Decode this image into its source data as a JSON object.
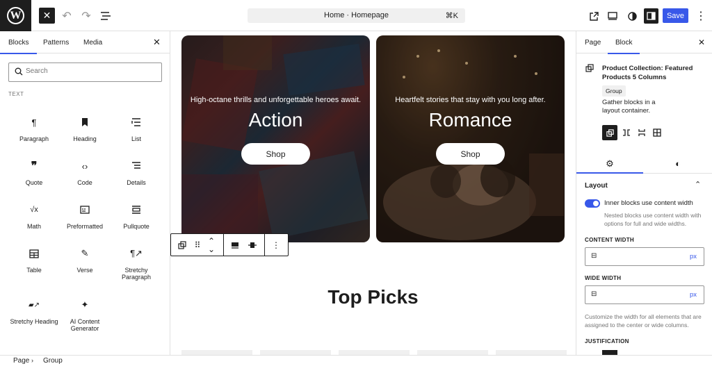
{
  "topbar": {
    "logo": "W",
    "close_icon": "close-icon",
    "document_title": "Home · Homepage",
    "shortcut": "⌘K",
    "save_label": "Save",
    "accent_color": "#3858e9"
  },
  "inserter": {
    "tabs": [
      "Blocks",
      "Patterns",
      "Media"
    ],
    "active_tab": "Blocks",
    "search_placeholder": "Search",
    "category": "TEXT",
    "blocks": [
      {
        "label": "Paragraph",
        "icon": "¶"
      },
      {
        "label": "Heading",
        "icon": "🔖"
      },
      {
        "label": "List",
        "icon": "☰"
      },
      {
        "label": "Quote",
        "icon": "❞"
      },
      {
        "label": "Code",
        "icon": "‹›"
      },
      {
        "label": "Details",
        "icon": "≡"
      },
      {
        "label": "Math",
        "icon": "√x"
      },
      {
        "label": "Preformatted",
        "icon": "▤"
      },
      {
        "label": "Pullquote",
        "icon": "▭"
      },
      {
        "label": "Table",
        "icon": "▦"
      },
      {
        "label": "Verse",
        "icon": "✎"
      },
      {
        "label": "Stretchy Paragraph",
        "icon": "¶↗"
      },
      {
        "label": "Stretchy Heading",
        "icon": "▰↗"
      },
      {
        "label": "AI Content Generator",
        "icon": "✦"
      }
    ]
  },
  "canvas": {
    "cards": [
      {
        "tagline": "High-octane thrills and unforgettable heroes await.",
        "heading": "Action",
        "button": "Shop"
      },
      {
        "tagline": "Heartfelt stories that stay with you long after.",
        "heading": "Romance",
        "button": "Shop"
      }
    ],
    "section_heading": "Top Picks"
  },
  "settings": {
    "tabs": [
      "Page",
      "Block"
    ],
    "active_tab": "Block",
    "block_title": "Product Collection: Featured Products 5 Columns",
    "block_badge": "Group",
    "block_description": "Gather blocks in a layout container.",
    "layout_title": "Layout",
    "toggle_label": "Inner blocks use content width",
    "toggle_on": true,
    "toggle_help": "Nested blocks use content width with options for full and wide widths.",
    "content_width_label": "CONTENT WIDTH",
    "wide_width_label": "WIDE WIDTH",
    "unit": "px",
    "width_help": "Customize the width for all elements that are assigned to the center or wide columns.",
    "justification_label": "JUSTIFICATION"
  },
  "breadcrumb": [
    "Page",
    "Group"
  ]
}
